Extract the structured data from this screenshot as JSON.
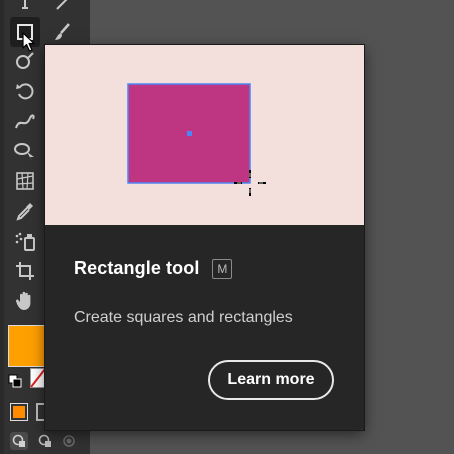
{
  "toolbar": {
    "tools": [
      {
        "name": "type-tool-icon"
      },
      {
        "name": "line-segment-tool-icon"
      },
      {
        "name": "rectangle-tool-icon",
        "selected": true
      },
      {
        "name": "paintbrush-tool-icon"
      },
      {
        "name": "shaper-tool-icon"
      },
      {
        "name": "rotate-tool-icon"
      },
      {
        "name": "warp-tool-icon"
      },
      {
        "name": "shape-builder-tool-icon"
      },
      {
        "name": "perspective-grid-tool-icon"
      },
      {
        "name": "eyedropper-tool-icon"
      },
      {
        "name": "symbol-sprayer-tool-icon"
      },
      {
        "name": "artboard-tool-icon"
      },
      {
        "name": "hand-tool-icon"
      }
    ],
    "fill_color": "#FFA000",
    "stroke": "none",
    "draw_mode_fill_color": "#FF8C00"
  },
  "popover": {
    "title": "Rectangle tool",
    "shortcut": "M",
    "description": "Create squares and rectangles",
    "learn_more_label": "Learn more",
    "preview": {
      "background": "#F3E0DC",
      "shape_color": "#BE3582",
      "selection_color": "#4E86F5"
    }
  }
}
